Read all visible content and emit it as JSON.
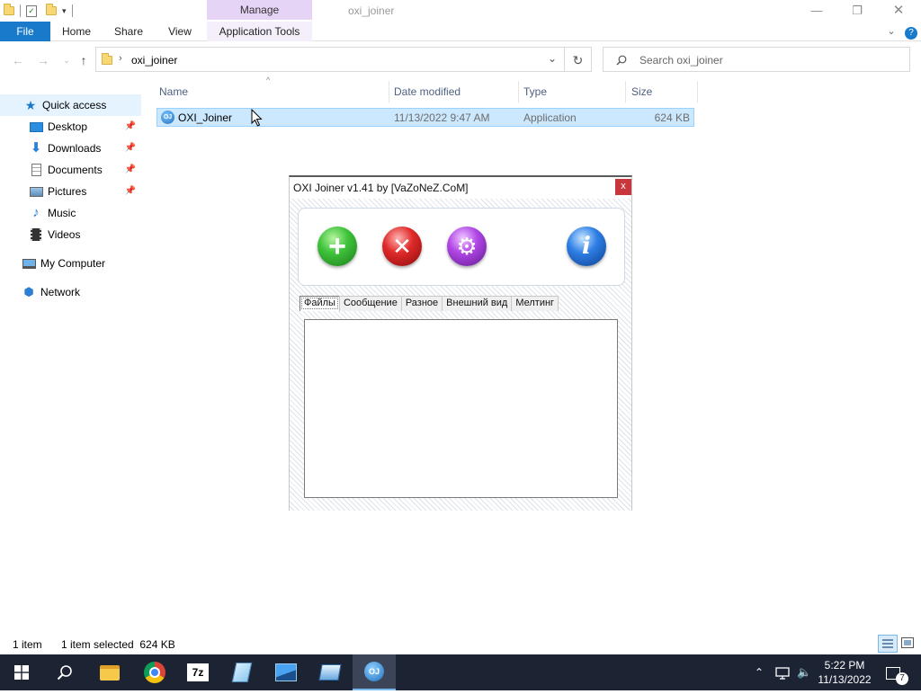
{
  "window": {
    "title": "oxi_joiner",
    "context_tab_group": "Manage",
    "controls": {
      "minimize": "—",
      "maximize": "❐",
      "close": "✕"
    }
  },
  "ribbon": {
    "tabs": [
      {
        "label": "File"
      },
      {
        "label": "Home"
      },
      {
        "label": "Share"
      },
      {
        "label": "View"
      },
      {
        "label": "Application Tools"
      }
    ],
    "expand_icon": "chevron-down-icon",
    "help_icon": "help-icon"
  },
  "address": {
    "path": "oxi_joiner",
    "search_placeholder": "Search oxi_joiner"
  },
  "nav_pane": {
    "items": [
      {
        "label": "Quick access",
        "icon": "star-icon",
        "pinned": false
      },
      {
        "label": "Desktop",
        "icon": "desktop-icon",
        "pinned": true
      },
      {
        "label": "Downloads",
        "icon": "download-icon",
        "pinned": true
      },
      {
        "label": "Documents",
        "icon": "document-icon",
        "pinned": true
      },
      {
        "label": "Pictures",
        "icon": "picture-icon",
        "pinned": true
      },
      {
        "label": "Music",
        "icon": "music-icon",
        "pinned": false
      },
      {
        "label": "Videos",
        "icon": "video-icon",
        "pinned": false
      },
      {
        "label": "My Computer",
        "icon": "computer-icon",
        "pinned": false
      },
      {
        "label": "Network",
        "icon": "network-icon",
        "pinned": false
      }
    ]
  },
  "file_list": {
    "columns": [
      "Name",
      "Date modified",
      "Type",
      "Size"
    ],
    "rows": [
      {
        "name": "OXI_Joiner",
        "date": "11/13/2022 9:47 AM",
        "type": "Application",
        "size": "624 KB"
      }
    ]
  },
  "status": {
    "count": "1 item",
    "selection": "1 item selected  624 KB"
  },
  "oxi_dialog": {
    "title": "OXI Joiner v1.41 by [VaZoNeZ.CoM]",
    "close_label": "x",
    "toolbar_icons": [
      "add-icon",
      "remove-icon",
      "settings-icon",
      "info-icon"
    ],
    "tabs": [
      "Файлы",
      "Сообщение",
      "Разное",
      "Внешний вид",
      "Мелтинг"
    ],
    "active_tab": "Файлы"
  },
  "taskbar": {
    "time": "5:22 PM",
    "date": "11/13/2022",
    "notification_count": "7",
    "apps": [
      "start-icon",
      "search-icon",
      "file-explorer-icon",
      "chrome-icon",
      "7zip-icon",
      "notepad-icon",
      "photos-icon",
      "app-icon",
      "oxi-joiner-icon"
    ]
  },
  "colors": {
    "accent": "#1979ca",
    "selection": "#cce8ff",
    "manage_context": "#e6d4f7",
    "taskbar": "#1c2434"
  }
}
